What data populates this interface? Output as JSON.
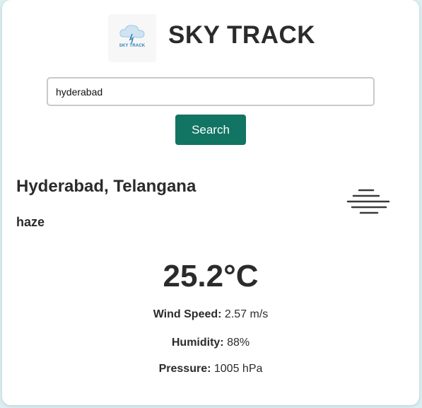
{
  "app": {
    "logo_text": "SKY TRACK",
    "title": "SKY TRACK"
  },
  "search": {
    "value": "hyderabad",
    "button_label": "Search"
  },
  "weather": {
    "location": "Hyderabad, Telangana",
    "condition": "haze",
    "condition_icon": "haze-icon",
    "temperature": "25.2°C",
    "wind_label": "Wind Speed:",
    "wind_value": "2.57 m/s",
    "humidity_label": "Humidity:",
    "humidity_value": "88%",
    "pressure_label": "Pressure:",
    "pressure_value": "1005 hPa"
  },
  "colors": {
    "accent": "#127462",
    "background": "#dbeef2",
    "text": "#2b2b2b"
  }
}
